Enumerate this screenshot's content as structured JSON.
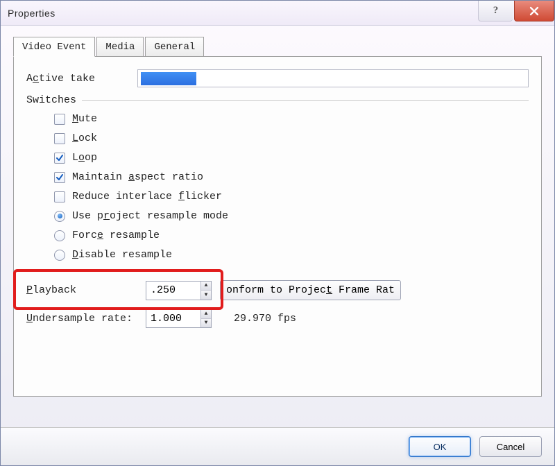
{
  "window": {
    "title": "Properties"
  },
  "tabs": [
    {
      "label": "Video Event",
      "active": true
    },
    {
      "label": "Media",
      "active": false
    },
    {
      "label": "General",
      "active": false
    }
  ],
  "activeTake": {
    "label_pre": "A",
    "label_mn": "c",
    "label_post": "tive take"
  },
  "switches": {
    "header": "Switches",
    "mute": {
      "pre": "",
      "mn": "M",
      "post": "ute",
      "checked": false
    },
    "lock": {
      "pre": "",
      "mn": "L",
      "post": "ock",
      "checked": false
    },
    "loop": {
      "pre": "L",
      "mn": "o",
      "post": "op",
      "checked": true
    },
    "aspect": {
      "pre": "Maintain ",
      "mn": "a",
      "post": "spect ratio",
      "checked": true
    },
    "reduce": {
      "pre": "Reduce interlace ",
      "mn": "f",
      "post": "licker",
      "checked": false
    }
  },
  "resample": {
    "project": {
      "pre": "Use p",
      "mn": "r",
      "post": "oject resample mode",
      "selected": true
    },
    "force": {
      "pre": "Forc",
      "mn": "e",
      "post": " resample",
      "selected": false
    },
    "disable": {
      "pre": "",
      "mn": "D",
      "post": "isable resample",
      "selected": false
    }
  },
  "playback": {
    "pre": "",
    "mn": "P",
    "post": "layback",
    "value": ".250"
  },
  "conform": {
    "pre": "onform to Projec",
    "mn": "t",
    "post": " Frame Rat"
  },
  "undersample": {
    "pre": "",
    "mn": "U",
    "post": "ndersample rate:",
    "value": "1.000"
  },
  "fps": "29.970 fps",
  "buttons": {
    "ok": "OK",
    "cancel": "Cancel"
  }
}
